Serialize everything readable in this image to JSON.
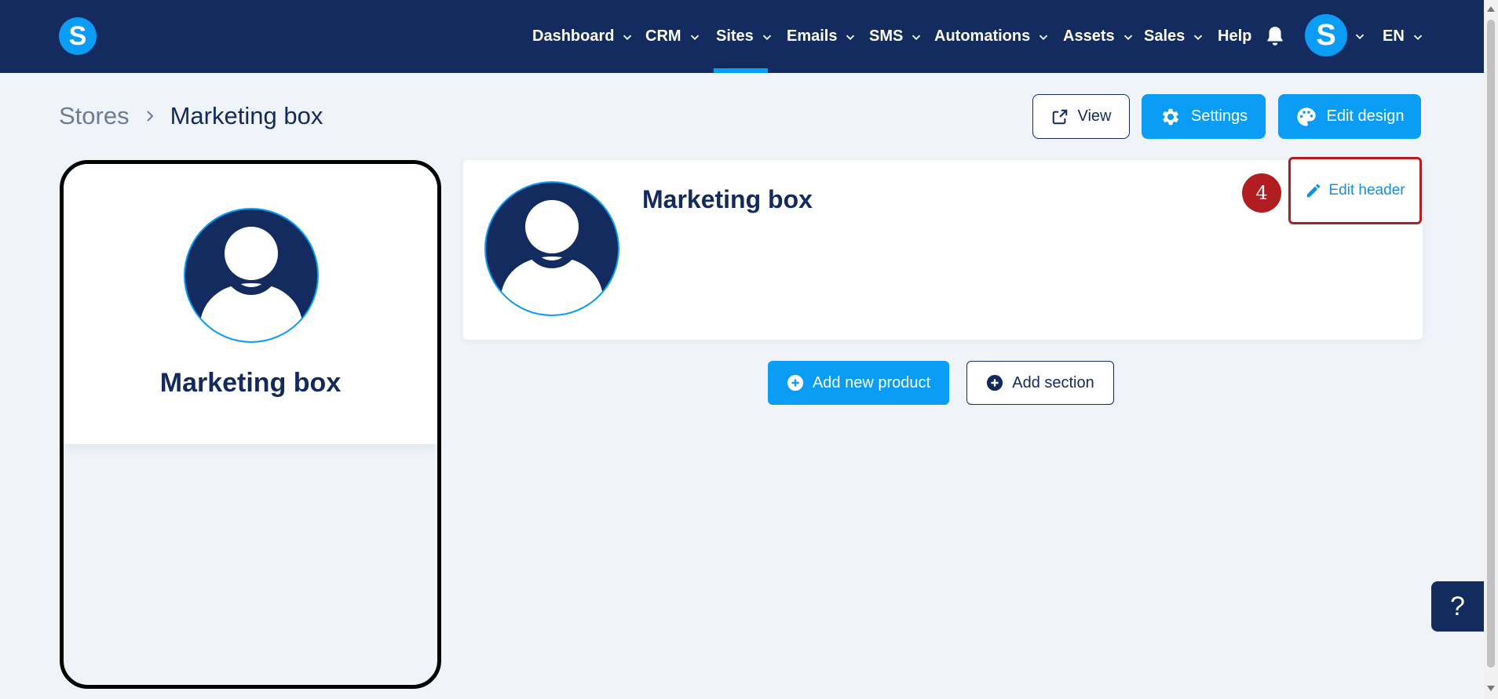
{
  "nav": {
    "logo_letter": "S",
    "items": [
      {
        "label": "Dashboard"
      },
      {
        "label": "CRM"
      },
      {
        "label": "Sites"
      },
      {
        "label": "Emails"
      },
      {
        "label": "SMS"
      },
      {
        "label": "Automations"
      },
      {
        "label": "Assets"
      },
      {
        "label": "Sales"
      },
      {
        "label": "Help"
      }
    ],
    "active_item": "Sites",
    "avatar_letter": "S",
    "language": "EN"
  },
  "breadcrumb": {
    "root": "Stores",
    "current": "Marketing box"
  },
  "actions": {
    "view_label": "View",
    "settings_label": "Settings",
    "edit_design_label": "Edit design"
  },
  "preview": {
    "store_name": "Marketing box"
  },
  "header_card": {
    "store_name": "Marketing box",
    "step_number": "4",
    "edit_header_label": "Edit header"
  },
  "main": {
    "add_product_label": "Add new product",
    "add_section_label": "Add section"
  },
  "help_fab": {
    "label": "?"
  },
  "colors": {
    "nav_bg": "#132b5e",
    "accent": "#0b9cf5",
    "highlight": "#b11d20",
    "page_bg": "#f0f4f9",
    "text_dark": "#14295c"
  }
}
